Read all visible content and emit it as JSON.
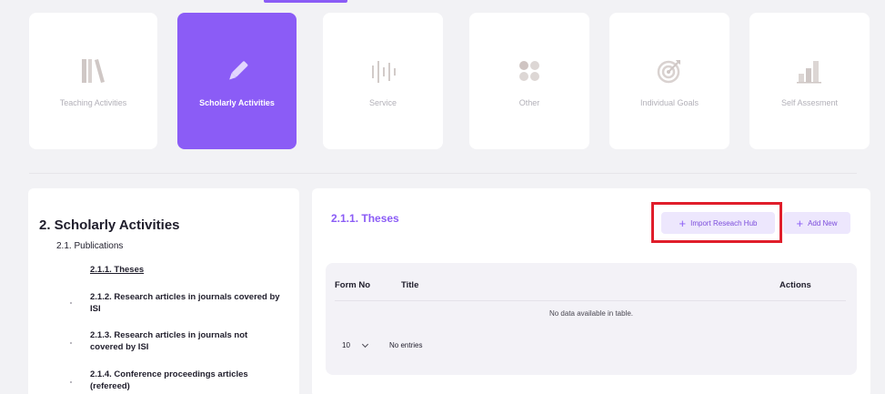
{
  "categories": [
    {
      "label": "Teaching Activities",
      "icon": "books-icon",
      "active": false
    },
    {
      "label": "Scholarly Activities",
      "icon": "pencil-icon",
      "active": true
    },
    {
      "label": "Service",
      "icon": "bars-icon",
      "active": false
    },
    {
      "label": "Other",
      "icon": "dots-grid-icon",
      "active": false
    },
    {
      "label": "Individual Goals",
      "icon": "target-icon",
      "active": false
    },
    {
      "label": "Self Assesment",
      "icon": "chart-icon",
      "active": false
    }
  ],
  "sidebar": {
    "section_title": "2. Scholarly Activities",
    "group_title": "2.1. Publications",
    "items": [
      {
        "label": "2.1.1. Theses"
      },
      {
        "label": "2.1.2. Research articles in journals covered by ISI"
      },
      {
        "label": "2.1.3. Research articles in journals not covered by ISI"
      },
      {
        "label": "2.1.4. Conference proceedings articles (refereed)"
      }
    ]
  },
  "main": {
    "title": "2.1.1. Theses",
    "import_button_label": "Import Reseach Hub",
    "add_button_label": "Add New",
    "plus_glyph": "+",
    "table": {
      "columns": [
        "Form No",
        "Title",
        "Actions"
      ],
      "empty_message": "No data available in table.",
      "page_size": "10",
      "entries_text": "No entries"
    }
  },
  "colors": {
    "accent": "#8b5cf6",
    "highlight": "#e01e2b",
    "button_bg": "#ede7fd"
  }
}
